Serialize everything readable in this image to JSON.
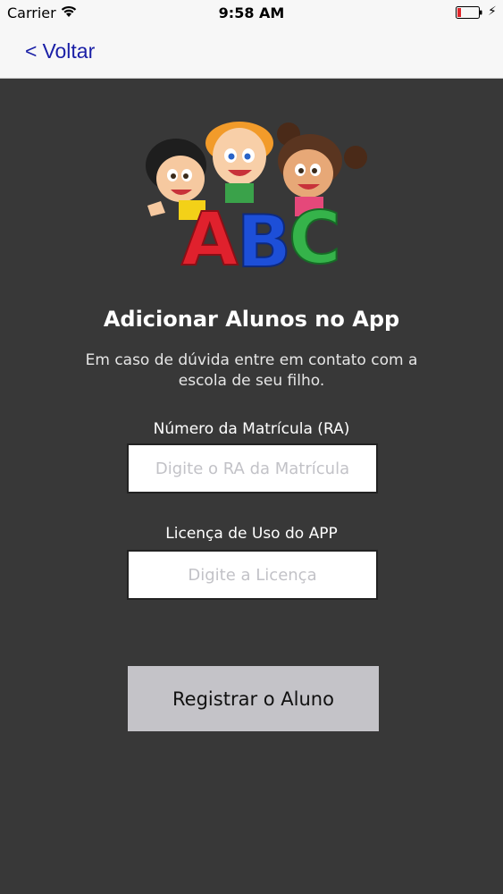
{
  "status_bar": {
    "carrier": "Carrier",
    "time": "9:58 AM",
    "battery_color": "#e0262b"
  },
  "nav": {
    "back_label": "Voltar",
    "back_chevron": "<",
    "accent": "#1a1fa6"
  },
  "logo": {
    "letters": [
      "A",
      "B",
      "C"
    ],
    "letter_colors": [
      "#e0212d",
      "#1d4fd8",
      "#35b34a"
    ]
  },
  "main": {
    "title": "Adicionar Alunos no App",
    "subtitle": "Em caso de dúvida entre em contato com a escola de seu filho.",
    "background": "#383838"
  },
  "form": {
    "ra_label": "Número da Matrícula (RA)",
    "ra_value": "",
    "ra_placeholder": "Digite o RA da Matrícula",
    "license_label": "Licença de Uso do APP",
    "license_value": "",
    "license_placeholder": "Digite a Licença",
    "submit_label": "Registrar o Aluno"
  },
  "icons": [
    "wifi-icon",
    "battery-icon",
    "charging-bolt-icon",
    "back-chevron-icon"
  ]
}
